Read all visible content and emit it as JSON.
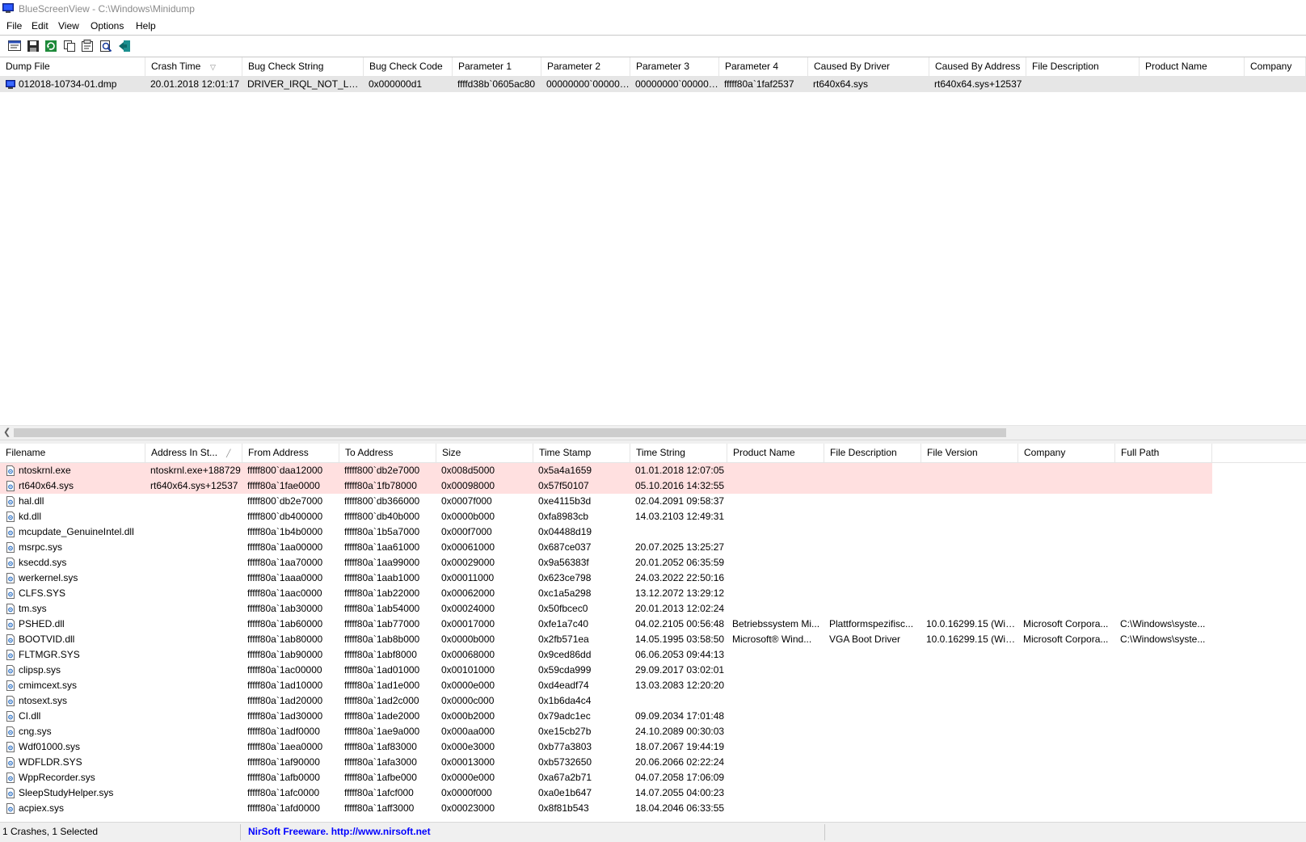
{
  "window": {
    "title": "BlueScreenView  -  C:\\Windows\\Minidump"
  },
  "menu": {
    "file": "File",
    "edit": "Edit",
    "view": "View",
    "options": "Options",
    "help": "Help"
  },
  "toolbar": {
    "icons": [
      "properties-icon",
      "save-icon",
      "refresh-icon",
      "copy-icon",
      "html-report-icon",
      "find-icon",
      "exit-icon"
    ]
  },
  "crash_table": {
    "headers": [
      "Dump File",
      "Crash Time",
      "Bug Check String",
      "Bug Check Code",
      "Parameter 1",
      "Parameter 2",
      "Parameter 3",
      "Parameter 4",
      "Caused By Driver",
      "Caused By Address",
      "File Description",
      "Product Name",
      "Company"
    ],
    "rows": [
      [
        "012018-10734-01.dmp",
        "20.01.2018 12:01:17",
        "DRIVER_IRQL_NOT_LESS...",
        "0x000000d1",
        "ffffd38b`0605ac80",
        "00000000`000000...",
        "00000000`000000...",
        "fffff80a`1faf2537",
        "rt640x64.sys",
        "rt640x64.sys+12537",
        "",
        "",
        ""
      ]
    ]
  },
  "driver_table": {
    "headers": [
      "Filename",
      "Address In St...",
      "From Address",
      "To Address",
      "Size",
      "Time Stamp",
      "Time String",
      "Product Name",
      "File Description",
      "File Version",
      "Company",
      "Full Path"
    ],
    "rows": [
      [
        "ntoskrnl.exe",
        "ntoskrnl.exe+188729",
        "fffff800`daa12000",
        "fffff800`db2e7000",
        "0x008d5000",
        "0x5a4a1659",
        "01.01.2018 12:07:05",
        "",
        "",
        "",
        "",
        ""
      ],
      [
        "rt640x64.sys",
        "rt640x64.sys+12537",
        "fffff80a`1fae0000",
        "fffff80a`1fb78000",
        "0x00098000",
        "0x57f50107",
        "05.10.2016 14:32:55",
        "",
        "",
        "",
        "",
        ""
      ],
      [
        "hal.dll",
        "",
        "fffff800`db2e7000",
        "fffff800`db366000",
        "0x0007f000",
        "0xe4115b3d",
        "02.04.2091 09:58:37",
        "",
        "",
        "",
        "",
        ""
      ],
      [
        "kd.dll",
        "",
        "fffff800`db400000",
        "fffff800`db40b000",
        "0x0000b000",
        "0xfa8983cb",
        "14.03.2103 12:49:31",
        "",
        "",
        "",
        "",
        ""
      ],
      [
        "mcupdate_GenuineIntel.dll",
        "",
        "fffff80a`1b4b0000",
        "fffff80a`1b5a7000",
        "0x000f7000",
        "0x04488d19",
        "",
        "",
        "",
        "",
        "",
        ""
      ],
      [
        "msrpc.sys",
        "",
        "fffff80a`1aa00000",
        "fffff80a`1aa61000",
        "0x00061000",
        "0x687ce037",
        "20.07.2025 13:25:27",
        "",
        "",
        "",
        "",
        ""
      ],
      [
        "ksecdd.sys",
        "",
        "fffff80a`1aa70000",
        "fffff80a`1aa99000",
        "0x00029000",
        "0x9a56383f",
        "20.01.2052 06:35:59",
        "",
        "",
        "",
        "",
        ""
      ],
      [
        "werkernel.sys",
        "",
        "fffff80a`1aaa0000",
        "fffff80a`1aab1000",
        "0x00011000",
        "0x623ce798",
        "24.03.2022 22:50:16",
        "",
        "",
        "",
        "",
        ""
      ],
      [
        "CLFS.SYS",
        "",
        "fffff80a`1aac0000",
        "fffff80a`1ab22000",
        "0x00062000",
        "0xc1a5a298",
        "13.12.2072 13:29:12",
        "",
        "",
        "",
        "",
        ""
      ],
      [
        "tm.sys",
        "",
        "fffff80a`1ab30000",
        "fffff80a`1ab54000",
        "0x00024000",
        "0x50fbcec0",
        "20.01.2013 12:02:24",
        "",
        "",
        "",
        "",
        ""
      ],
      [
        "PSHED.dll",
        "",
        "fffff80a`1ab60000",
        "fffff80a`1ab77000",
        "0x00017000",
        "0xfe1a7c40",
        "04.02.2105 00:56:48",
        "Betriebssystem Mi...",
        "Plattformspezifisc...",
        "10.0.16299.15 (Win...",
        "Microsoft Corpora...",
        "C:\\Windows\\syste..."
      ],
      [
        "BOOTVID.dll",
        "",
        "fffff80a`1ab80000",
        "fffff80a`1ab8b000",
        "0x0000b000",
        "0x2fb571ea",
        "14.05.1995 03:58:50",
        "Microsoft® Wind...",
        "VGA Boot Driver",
        "10.0.16299.15 (Win...",
        "Microsoft Corpora...",
        "C:\\Windows\\syste..."
      ],
      [
        "FLTMGR.SYS",
        "",
        "fffff80a`1ab90000",
        "fffff80a`1abf8000",
        "0x00068000",
        "0x9ced86dd",
        "06.06.2053 09:44:13",
        "",
        "",
        "",
        "",
        ""
      ],
      [
        "clipsp.sys",
        "",
        "fffff80a`1ac00000",
        "fffff80a`1ad01000",
        "0x00101000",
        "0x59cda999",
        "29.09.2017 03:02:01",
        "",
        "",
        "",
        "",
        ""
      ],
      [
        "cmimcext.sys",
        "",
        "fffff80a`1ad10000",
        "fffff80a`1ad1e000",
        "0x0000e000",
        "0xd4eadf74",
        "13.03.2083 12:20:20",
        "",
        "",
        "",
        "",
        ""
      ],
      [
        "ntosext.sys",
        "",
        "fffff80a`1ad20000",
        "fffff80a`1ad2c000",
        "0x0000c000",
        "0x1b6da4c4",
        "",
        "",
        "",
        "",
        "",
        ""
      ],
      [
        "CI.dll",
        "",
        "fffff80a`1ad30000",
        "fffff80a`1ade2000",
        "0x000b2000",
        "0x79adc1ec",
        "09.09.2034 17:01:48",
        "",
        "",
        "",
        "",
        ""
      ],
      [
        "cng.sys",
        "",
        "fffff80a`1adf0000",
        "fffff80a`1ae9a000",
        "0x000aa000",
        "0xe15cb27b",
        "24.10.2089 00:30:03",
        "",
        "",
        "",
        "",
        ""
      ],
      [
        "Wdf01000.sys",
        "",
        "fffff80a`1aea0000",
        "fffff80a`1af83000",
        "0x000e3000",
        "0xb77a3803",
        "18.07.2067 19:44:19",
        "",
        "",
        "",
        "",
        ""
      ],
      [
        "WDFLDR.SYS",
        "",
        "fffff80a`1af90000",
        "fffff80a`1afa3000",
        "0x00013000",
        "0xb5732650",
        "20.06.2066 02:22:24",
        "",
        "",
        "",
        "",
        ""
      ],
      [
        "WppRecorder.sys",
        "",
        "fffff80a`1afb0000",
        "fffff80a`1afbe000",
        "0x0000e000",
        "0xa67a2b71",
        "04.07.2058 17:06:09",
        "",
        "",
        "",
        "",
        ""
      ],
      [
        "SleepStudyHelper.sys",
        "",
        "fffff80a`1afc0000",
        "fffff80a`1afcf000",
        "0x0000f000",
        "0xa0e1b647",
        "14.07.2055 04:00:23",
        "",
        "",
        "",
        "",
        ""
      ],
      [
        "acpiex.sys",
        "",
        "fffff80a`1afd0000",
        "fffff80a`1aff3000",
        "0x00023000",
        "0x8f81b543",
        "18.04.2046 06:33:55",
        "",
        "",
        "",
        "",
        ""
      ]
    ],
    "highlighted_rows": 2
  },
  "status": {
    "count": "1 Crashes, 1 Selected",
    "credit": "NirSoft Freeware.  http://www.nirsoft.net"
  },
  "colors": {
    "highlight_row": "#ffe0e0",
    "selected_row": "#e6e6e6",
    "link_blue": "#0000ff"
  }
}
